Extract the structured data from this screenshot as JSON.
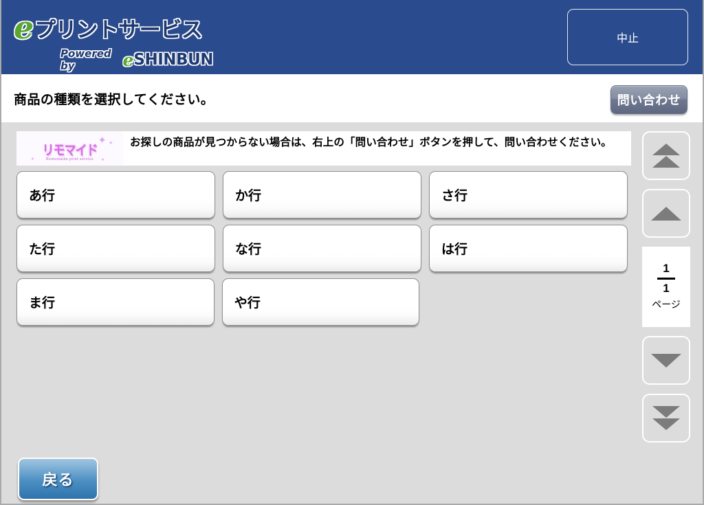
{
  "header": {
    "logo": {
      "e_mark": "e",
      "service_name": "プリントサービス",
      "powered_by": "Powered by",
      "powered_e": "e",
      "powered_brand": "SHINBUN"
    },
    "cancel_label": "中止"
  },
  "instruction": {
    "text": "商品の種類を選択してください。",
    "inquiry_label": "問い合わせ"
  },
  "notice": {
    "logo_brand": "リモマイド",
    "logo_tagline": "Remomaido print service",
    "message": "お探しの商品が見つからない場合は、右上の「問い合わせ」ボタンを押して、問い合わせください。"
  },
  "kana_buttons": [
    [
      {
        "label": "あ行"
      },
      {
        "label": "か行"
      },
      {
        "label": "さ行"
      }
    ],
    [
      {
        "label": "た行"
      },
      {
        "label": "な行"
      },
      {
        "label": "は行"
      }
    ],
    [
      {
        "label": "ま行"
      },
      {
        "label": "や行"
      }
    ]
  ],
  "pager": {
    "first_icon": "double-up-arrow-icon",
    "prev_icon": "up-arrow-icon",
    "current_page": "1",
    "total_pages": "1",
    "page_unit": "ページ",
    "next_icon": "down-arrow-icon",
    "last_icon": "double-down-arrow-icon"
  },
  "footer": {
    "back_label": "戻る"
  },
  "colors": {
    "header_blue": "#2a4b8d",
    "content_gray": "#dcdcdc",
    "back_button_blue": "#4c8fc2",
    "inquiry_gray": "#6f788f",
    "arrow_gray": "#7c7c7c",
    "logo_green": "#5aa832",
    "brand_pink": "#d36fe0"
  }
}
